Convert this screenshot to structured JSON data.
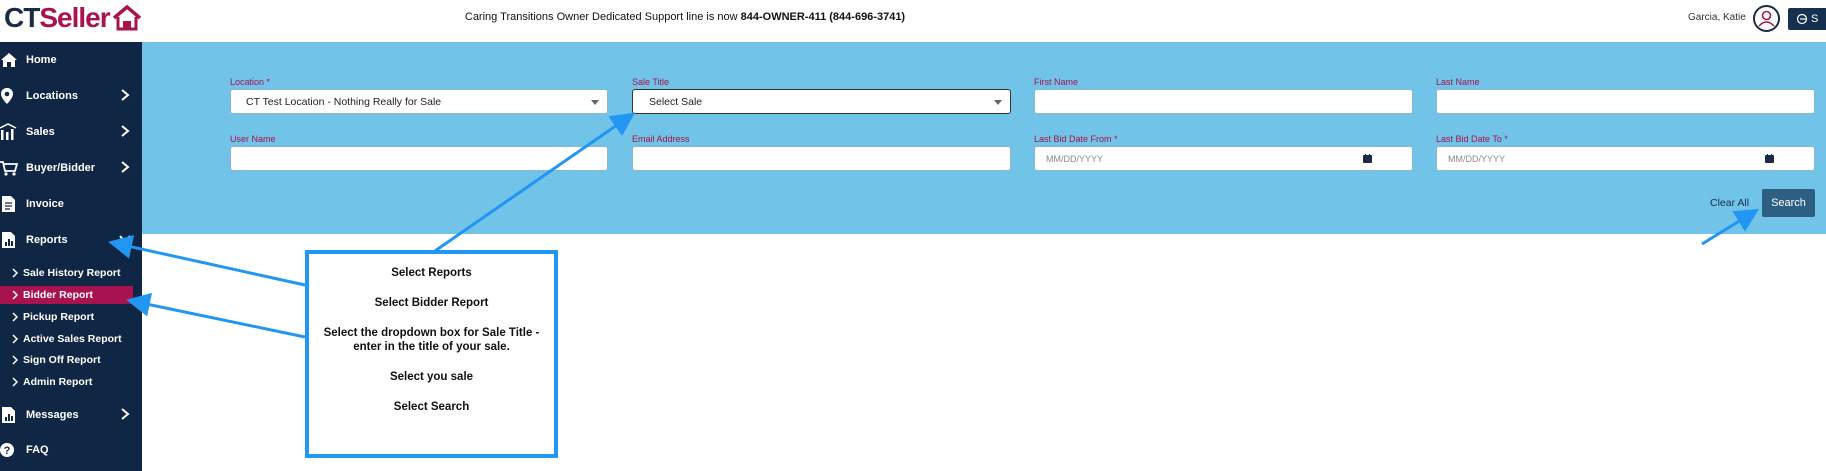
{
  "header": {
    "logo_ct": "CT",
    "logo_seller": "Seller",
    "support_prefix": "Caring Transitions Owner Dedicated Support line is now ",
    "support_number": "844-OWNER-411 (844-696-3741)",
    "user_name": "Garcia, Katie",
    "signout_label": "S"
  },
  "sidebar": {
    "items": [
      {
        "label": "Home",
        "icon": "home-icon"
      },
      {
        "label": "Locations",
        "icon": "map-pin-icon"
      },
      {
        "label": "Sales",
        "icon": "bar-chart-icon"
      },
      {
        "label": "Buyer/Bidder",
        "icon": "cart-icon"
      },
      {
        "label": "Invoice",
        "icon": "document-icon"
      },
      {
        "label": "Reports",
        "icon": "report-icon"
      },
      {
        "label": "Messages",
        "icon": "report-icon"
      },
      {
        "label": "FAQ",
        "icon": "question-icon"
      }
    ],
    "reports_sub": [
      {
        "label": "Sale History Report"
      },
      {
        "label": "Bidder Report"
      },
      {
        "label": "Pickup Report"
      },
      {
        "label": "Active Sales Report"
      },
      {
        "label": "Sign Off Report"
      },
      {
        "label": "Admin Report"
      }
    ]
  },
  "form": {
    "location_label": "Location *",
    "location_value": "CT Test Location - Nothing Really for Sale",
    "sale_title_label": "Sale Title",
    "sale_title_value": "Select Sale",
    "first_name_label": "First Name",
    "last_name_label": "Last Name",
    "user_name_label": "User Name",
    "email_label": "Email Address",
    "bid_from_label": "Last Bid Date From *",
    "bid_from_placeholder": "MM/DD/YYYY",
    "bid_to_label": "Last Bid Date To *",
    "bid_to_placeholder": "MM/DD/YYYY",
    "clear_all_label": "Clear All",
    "search_label": "Search"
  },
  "callout": {
    "line1": "Select Reports",
    "line2": "Select Bidder  Report",
    "line3a": "Select the dropdown box for Sale Title -",
    "line3b": "enter in the title of your sale.",
    "line4": "Select you sale",
    "line5": "Select Search"
  },
  "colors": {
    "navy": "#0f2744",
    "brand_magenta": "#a8124e",
    "panel_blue": "#71c3e8",
    "arrow_blue": "#2196f3",
    "search_button": "#2c5f82"
  }
}
